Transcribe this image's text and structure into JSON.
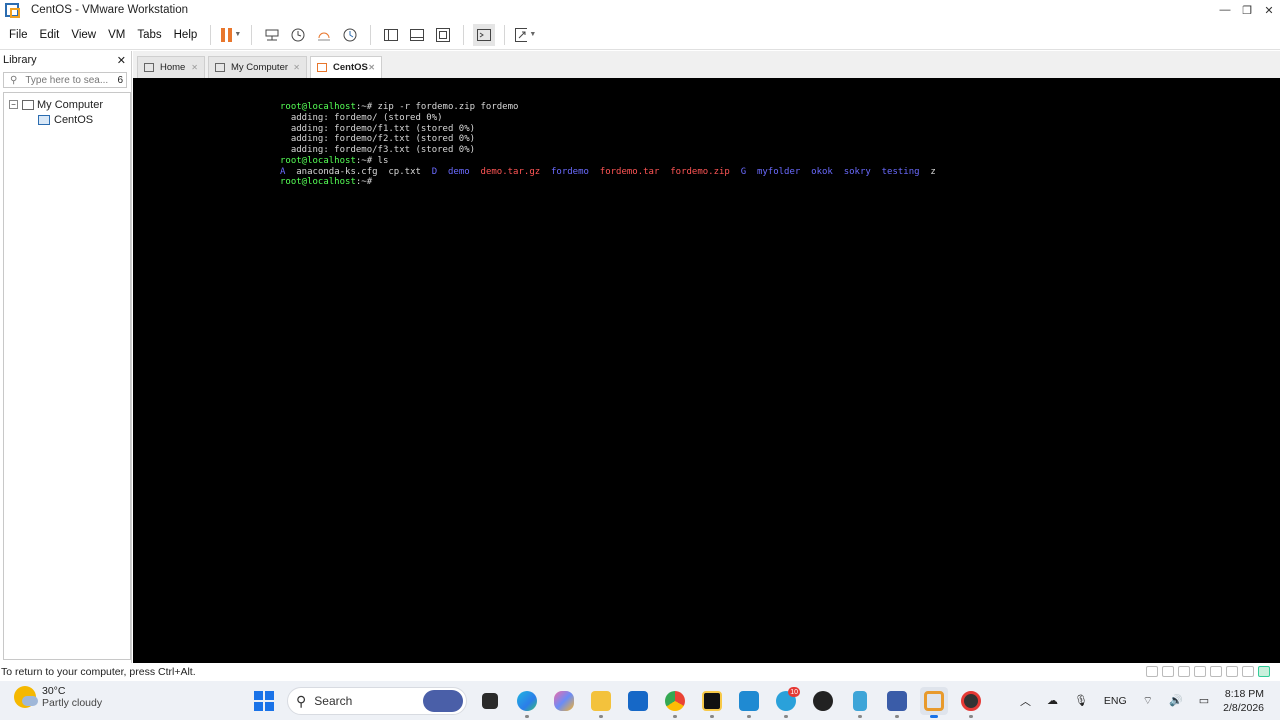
{
  "window": {
    "title": "CentOS - VMware Workstation",
    "controls": [
      "minimize-icon",
      "restore-icon",
      "close-icon"
    ]
  },
  "menu": {
    "items": [
      "File",
      "Edit",
      "View",
      "VM",
      "Tabs",
      "Help"
    ]
  },
  "library": {
    "title": "Library",
    "search_placeholder": "Type here to sea...",
    "search_count": "6",
    "tree": [
      {
        "label": "My Computer",
        "expander": "−"
      },
      {
        "label": "CentOS"
      }
    ]
  },
  "tabs": [
    {
      "label": "Home",
      "icon": "home-icon"
    },
    {
      "label": "My Computer",
      "icon": "computer-icon"
    },
    {
      "label": "CentOS",
      "icon": "vm-icon",
      "active": true
    }
  ],
  "terminal": {
    "prompt": "root@localhost",
    "lines": [
      {
        "prompt": "root@localhost",
        "rest": ":~# zip -r fordemo.zip fordemo"
      },
      {
        "text": "  adding: fordemo/ (stored 0%)"
      },
      {
        "text": "  adding: fordemo/f1.txt (stored 0%)"
      },
      {
        "text": "  adding: fordemo/f2.txt (stored 0%)"
      },
      {
        "text": "  adding: fordemo/f3.txt (stored 0%)"
      },
      {
        "prompt": "root@localhost",
        "rest": ":~# ls"
      }
    ],
    "ls_output": [
      {
        "name": "A",
        "color": "blue"
      },
      {
        "name": "anaconda-ks.cfg",
        "color": "white"
      },
      {
        "name": "cp.txt",
        "color": "white"
      },
      {
        "name": "D",
        "color": "blue"
      },
      {
        "name": "demo",
        "color": "blue"
      },
      {
        "name": "demo.tar.gz",
        "color": "red"
      },
      {
        "name": "fordemo",
        "color": "blue"
      },
      {
        "name": "fordemo.tar",
        "color": "red"
      },
      {
        "name": "fordemo.zip",
        "color": "red"
      },
      {
        "name": "G",
        "color": "blue"
      },
      {
        "name": "myfolder",
        "color": "blue"
      },
      {
        "name": "okok",
        "color": "blue"
      },
      {
        "name": "sokry",
        "color": "blue"
      },
      {
        "name": "testing",
        "color": "blue"
      },
      {
        "name": "z",
        "color": "white"
      }
    ],
    "final_prompt": {
      "prompt": "root@localhost",
      "rest": ":~# "
    }
  },
  "statusbar": {
    "text": "To return to your computer, press Ctrl+Alt."
  },
  "taskbar": {
    "weather_temp": "30°C",
    "weather_condition": "Partly cloudy",
    "search_label": "Search",
    "telegram_badge": "10",
    "language": "ENG",
    "time": "8:18 PM",
    "date": "2/8/2026"
  },
  "colors": {
    "prompt_green": "#55ff55",
    "dir_blue": "#6b6bff",
    "archive_red": "#ff5555",
    "vmware_orange": "#e8762c"
  }
}
